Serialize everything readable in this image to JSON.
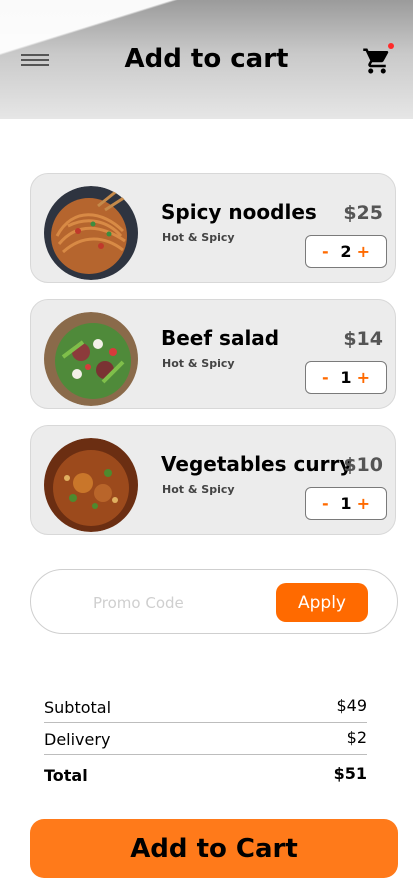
{
  "header": {
    "title": "Add to cart",
    "menu_icon": "menu-icon",
    "cart_icon": "cart-icon"
  },
  "items": [
    {
      "name": "Spicy noodles",
      "subtitle": "Hot & Spicy",
      "price": "$25",
      "quantity": "2",
      "minus": "-",
      "plus": "+"
    },
    {
      "name": "Beef salad",
      "subtitle": "Hot & Spicy",
      "price": "$14",
      "quantity": "1",
      "minus": "-",
      "plus": "+"
    },
    {
      "name": "Vegetables curry",
      "subtitle": "Hot & Spicy",
      "price": "$10",
      "quantity": "1",
      "minus": "-",
      "plus": "+"
    }
  ],
  "promo": {
    "placeholder": "Promo Code",
    "value": "",
    "apply_label": "Apply"
  },
  "summary": {
    "subtotal_label": "Subtotal",
    "subtotal_value": "$49",
    "delivery_label": "Delivery",
    "delivery_value": "$2",
    "total_label": "Total",
    "total_value": "$51"
  },
  "cta": {
    "label": "Add to Cart"
  },
  "colors": {
    "accent": "#ff6a00",
    "cta": "#ff7a1a",
    "card": "#ececec",
    "badge": "#ff2a2a"
  }
}
